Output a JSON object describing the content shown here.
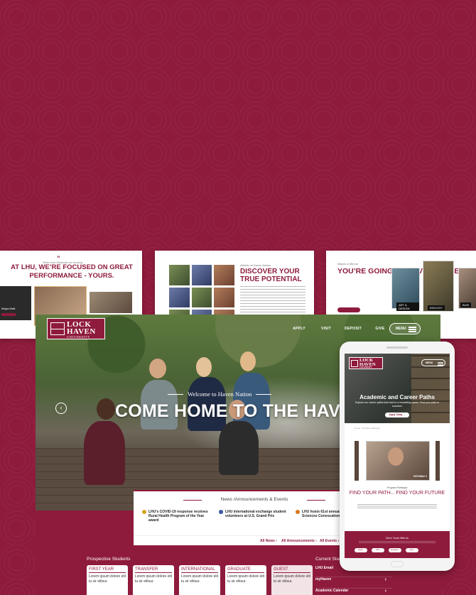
{
  "thumbnails": {
    "card1": {
      "quote_mark": "”",
      "small_caption": "When first Students run moving",
      "headline_part1": "AT LHU, WE’RE FOCUSED ON GREAT PERFORMANCE - ",
      "headline_emphasis": "YOURS.",
      "video_caption": "Megan Walk"
    },
    "card2": {
      "label": "Athletic at Haven Nation",
      "headline": "DISCOVER YOUR TRUE POTENTIAL"
    },
    "card3": {
      "label": "Majors & Minors",
      "headline": "YOU’RE GOING TO LOVE IT HERE.",
      "button": "Find Your Program →",
      "tags": [
        "ART & DESIGN",
        "BIOLOGY",
        "BUSI"
      ]
    }
  },
  "desktop": {
    "logo": {
      "line1": "LOCK",
      "line2": "HAVEN",
      "line3": "UNIVERSITY"
    },
    "nav": [
      "APPLY",
      "VISIT",
      "DEPOSIT",
      "GIVE"
    ],
    "menu_label": "MENU",
    "welcome": "Welcome to Haven Nation",
    "hero_title": "COME HOME TO THE HAVEN",
    "news": {
      "title": "News /Announcements & Events",
      "items": [
        "LHU’s COVID-19 response receives Rural Health Program of the Year award",
        "LHU international exchange student volunteers at U.S. Grand Prix",
        "LHU hosts 61st annual Natural Sciences Convocation"
      ],
      "links": [
        "All News ›",
        "All Announcements ›",
        "All Events ›"
      ]
    },
    "prospective": {
      "title": "Prospective Students",
      "cards": [
        {
          "title": "FIRST YEAR",
          "desc": "Lorem ipsum dolore elit tu sir elitsur."
        },
        {
          "title": "TRANSFER",
          "desc": "Lorem ipsum dolore elit tu sir elitsur."
        },
        {
          "title": "INTERNATIONAL",
          "desc": "Lorem ipsum dolore elit tu sir elitsur."
        },
        {
          "title": "GRADUATE",
          "desc": "Lorem ipsum dolore elit tu sir elitsur."
        },
        {
          "title": "GUEST",
          "desc": "Lorem ipsum dolore elit tu sir elitsur."
        }
      ]
    },
    "current": {
      "title": "Current Stud",
      "links": [
        "LHU Email",
        "myHaven",
        "Academic Calendar"
      ]
    }
  },
  "phone": {
    "logo": {
      "line1": "LOCK",
      "line2": "HAVEN",
      "line3": "UNIVERSITY"
    },
    "menu_label": "MENU",
    "hero_title": "Academic and Career Paths",
    "hero_sub": "Explore our career paths that lead to a rewarding career. Find your path to success!",
    "hero_button": "Apply Today →",
    "breadcrumb": "Home  ›  Program Pathways",
    "video_badge": "PATHWAY 2",
    "program_label": "Program Pathways",
    "find_title": "FIND YOUR PATH... FIND YOUR FUTURE",
    "footer_title": "Get In Touch With Us",
    "footer_buttons": [
      "Apply ›",
      "Visit ›",
      "Request ›",
      "Give ›"
    ]
  },
  "colors": {
    "brand": "#8e1b3c",
    "accent_gold": "#d9a41f"
  }
}
